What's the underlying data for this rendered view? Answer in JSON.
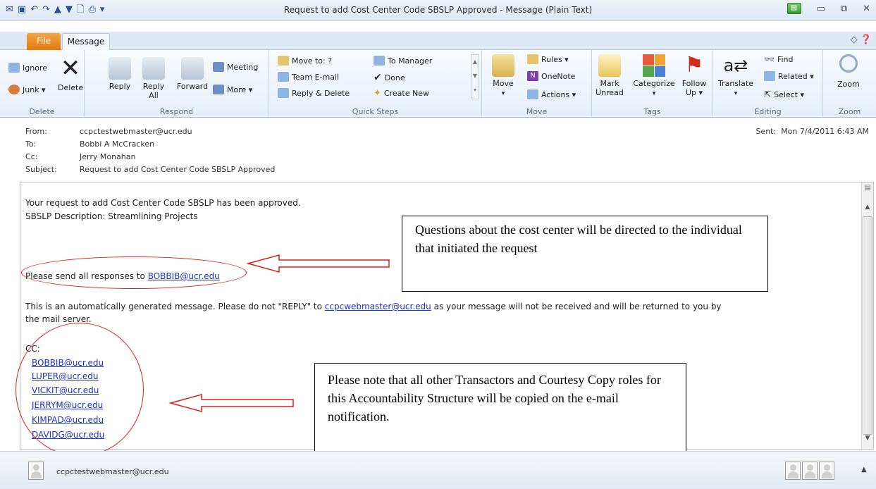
{
  "window": {
    "title": "Request to add Cost Center Code SBSLP Approved  -  Message (Plain Text)"
  },
  "tabs": {
    "file": "File",
    "message": "Message"
  },
  "ribbon": {
    "delete_group": {
      "label": "Delete",
      "ignore": "Ignore",
      "junk": "Junk ▾",
      "delete": "Delete"
    },
    "respond_group": {
      "label": "Respond",
      "reply": "Reply",
      "reply_all_1": "Reply",
      "reply_all_2": "All",
      "forward": "Forward",
      "meeting": "Meeting",
      "more": "More ▾"
    },
    "quicksteps_group": {
      "label": "Quick Steps",
      "move_to": "Move to: ?",
      "team_email": "Team E-mail",
      "reply_delete": "Reply & Delete",
      "to_manager": "To Manager",
      "done": "Done",
      "create_new": "Create New"
    },
    "move_group": {
      "label": "Move",
      "move": "Move",
      "rules": "Rules ▾",
      "onenote": "OneNote",
      "actions": "Actions ▾"
    },
    "tags_group": {
      "label": "Tags",
      "mark_unread_1": "Mark",
      "mark_unread_2": "Unread",
      "categorize": "Categorize",
      "follow_up_1": "Follow",
      "follow_up_2": "Up ▾"
    },
    "editing_group": {
      "label": "Editing",
      "translate": "Translate",
      "find": "Find",
      "related": "Related ▾",
      "select": "Select ▾"
    },
    "zoom_group": {
      "label": "Zoom",
      "zoom": "Zoom"
    }
  },
  "header": {
    "from_label": "From:",
    "from": "ccpctestwebmaster@ucr.edu",
    "to_label": "To:",
    "to": "Bobbi A McCracken",
    "cc_label": "Cc:",
    "cc": "Jerry Monahan",
    "subject_label": "Subject:",
    "subject": "Request to add Cost Center Code SBSLP Approved",
    "sent_label": "Sent:",
    "sent": "Mon 7/4/2011 6:43 AM"
  },
  "body": {
    "line1": "Your request to add Cost Center Code SBSLP has been approved.",
    "line2": "SBSLP Description: Streamlining Projects",
    "responses_prefix": "Please send all responses to ",
    "responses_link": "BOBBIB@ucr.edu",
    "auto_prefix": "This is an automatically generated message. Please do not \"REPLY\" to ",
    "auto_link": "ccpcwebmaster@ucr.edu",
    "auto_suffix": " as your message will not be received and will be returned to you by",
    "auto_line2": "the mail server.",
    "cc_heading": "CC:",
    "cc_list": [
      "BOBBIB@ucr.edu",
      "LUPER@ucr.edu",
      "VICKIT@ucr.edu",
      "JERRYM@ucr.edu",
      "KIMPAD@ucr.edu",
      "DAVIDG@ucr.edu"
    ]
  },
  "annotations": {
    "callout1": "Questions about the cost center will be directed to the individual that initiated the request",
    "callout2": "Please note that all other Transactors and Courtesy Copy roles for this Accountability Structure will be copied on the e-mail notification."
  },
  "footer": {
    "sender": "ccpctestwebmaster@ucr.edu"
  },
  "colors": {
    "annotation_red": "#e0201a",
    "link_blue": "#1a33cc",
    "file_tab": "#e07a10"
  }
}
